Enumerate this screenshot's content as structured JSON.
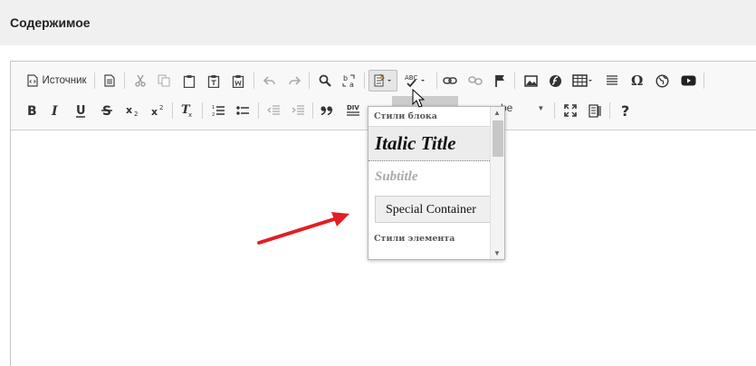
{
  "header": {
    "title": "Содержимое"
  },
  "toolbar": {
    "source_label": "Источник",
    "format_combo_value": "be"
  },
  "dropdown": {
    "block_styles_heading": "Стили блока",
    "items": [
      {
        "label": "Italic Title"
      },
      {
        "label": "Subtitle"
      },
      {
        "label": "Special Container"
      }
    ],
    "element_styles_heading": "Стили элемента"
  },
  "colors": {
    "arrow": "#e31e24",
    "header_bg": "#f0f0f0",
    "toolbar_bg": "#f8f8f8"
  },
  "icons": [
    "source-icon",
    "template-icon",
    "cut-icon",
    "copy-icon",
    "paste-icon",
    "paste-text-icon",
    "paste-word-icon",
    "undo-icon",
    "redo-icon",
    "find-icon",
    "replace-icon",
    "styles-icon",
    "spellcheck-icon",
    "link-icon",
    "unlink-icon",
    "anchor-icon",
    "image-icon",
    "flash-icon",
    "table-icon",
    "horizontal-rule-icon",
    "special-char-icon",
    "iframe-icon",
    "youtube-icon",
    "bold-icon",
    "italic-icon",
    "underline-icon",
    "strike-icon",
    "subscript-icon",
    "superscript-icon",
    "remove-format-icon",
    "numbered-list-icon",
    "bulleted-list-icon",
    "outdent-icon",
    "indent-icon",
    "blockquote-icon",
    "div-icon",
    "maximize-icon",
    "show-blocks-icon",
    "help-icon"
  ]
}
